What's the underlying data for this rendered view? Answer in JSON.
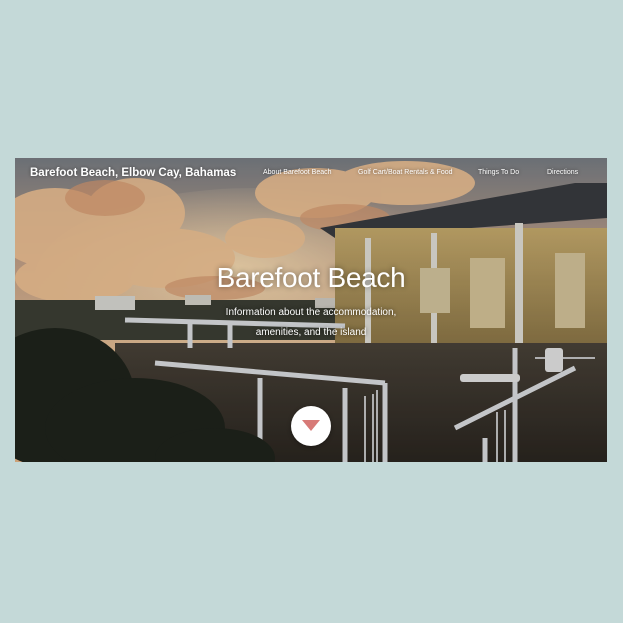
{
  "nav": {
    "brand": "Barefoot Beach, Elbow Cay, Bahamas",
    "items": [
      {
        "label": "About Barefoot Beach"
      },
      {
        "label": "Golf Cart/Boat Rentals & Food"
      },
      {
        "label": "Things To Do"
      },
      {
        "label": "Directions"
      }
    ]
  },
  "hero": {
    "title": "Barefoot Beach",
    "subtitle_line1": "Information about the accommodation,",
    "subtitle_line2": "amenities, and the island"
  },
  "icons": {
    "scroll_down": "chevron-down-icon"
  },
  "colors": {
    "page_background": "#c4d9d8",
    "scroll_button_arrow": "#d77a77",
    "text": "#ffffff"
  }
}
